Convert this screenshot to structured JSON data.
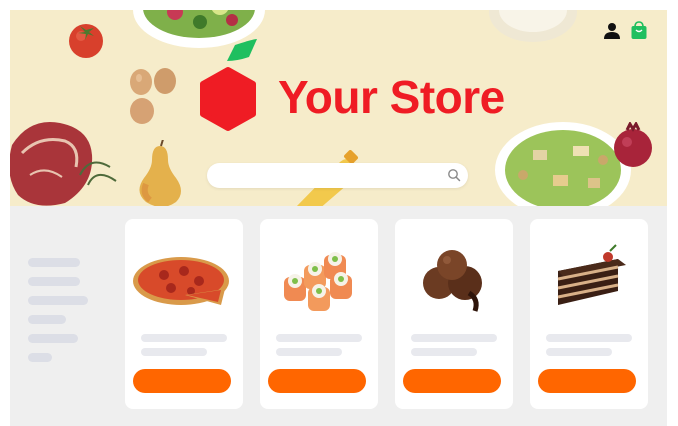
{
  "brand": {
    "name": "Your Store",
    "color": "#ef1c24",
    "leaf_color": "#1fbf5f"
  },
  "search": {
    "placeholder": "",
    "value": ""
  },
  "header": {
    "icons": [
      "user-icon",
      "shopping-bag-icon"
    ]
  },
  "colors": {
    "hero_background": "#f6ecca",
    "page_background": "#efefef",
    "button": "#ff6600",
    "placeholder_line": "#e8e9ee",
    "sidebar_line": "#dcdee6"
  },
  "sidebar": {
    "items": [
      "",
      "",
      "",
      "",
      "",
      ""
    ]
  },
  "products": [
    {
      "image": "pizza"
    },
    {
      "image": "sushi-rolls"
    },
    {
      "image": "chocolate-ice-cream"
    },
    {
      "image": "chocolate-cake-slice"
    }
  ]
}
